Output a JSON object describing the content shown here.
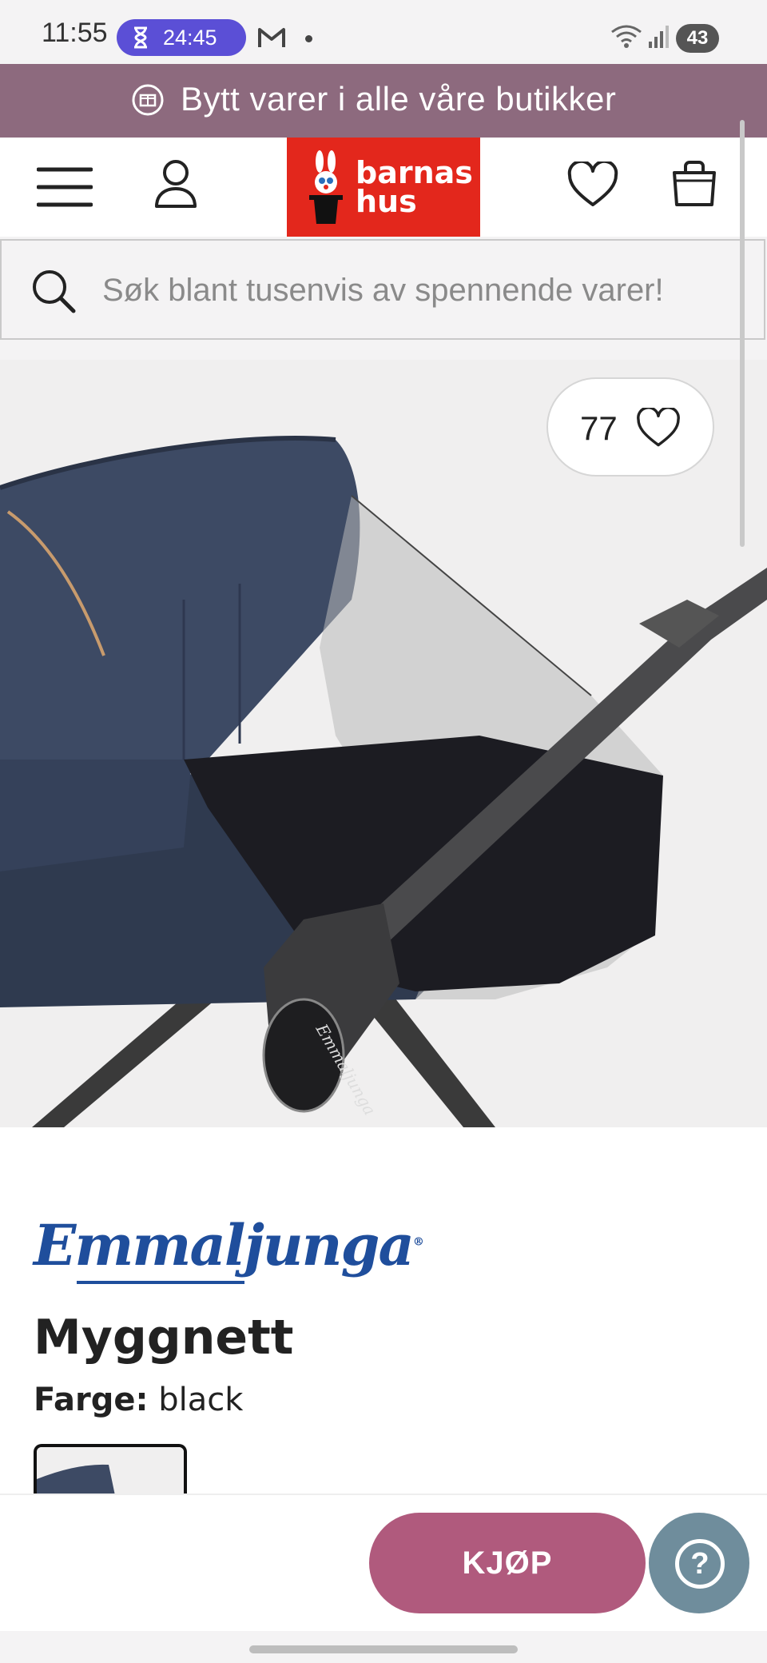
{
  "status_bar": {
    "time": "11:55",
    "timer": "24:45",
    "battery": "43",
    "icons": [
      "hourglass-icon",
      "gmail-icon",
      "wifi-icon",
      "signal-icon"
    ]
  },
  "promo_banner": {
    "text": "Bytt varer i alle våre butikker",
    "icon": "exchange-icon"
  },
  "header": {
    "logo_text_line1": "barnas",
    "logo_text_line2": "hus",
    "icons": [
      "menu-icon",
      "account-icon",
      "wishlist-icon",
      "cart-icon"
    ]
  },
  "search": {
    "placeholder": "Søk blant tusenvis av spennende varer!"
  },
  "product": {
    "like_count": "77",
    "brand": "Emmaljunga",
    "brand_mark": "®",
    "title": "Myggnett",
    "color_label": "Farge:",
    "color_value": "black",
    "stroller_badge": "Emmaljunga"
  },
  "actions": {
    "buy_label": "KJØP",
    "help_label": "?"
  },
  "colors": {
    "promo_bg": "#8d6a7e",
    "logo_bg": "#e3271c",
    "buy_button": "#b05a7d",
    "help_button": "#6f8d9c",
    "brand_blue": "#1f4e9c",
    "timer_pill": "#5b4fd6"
  }
}
